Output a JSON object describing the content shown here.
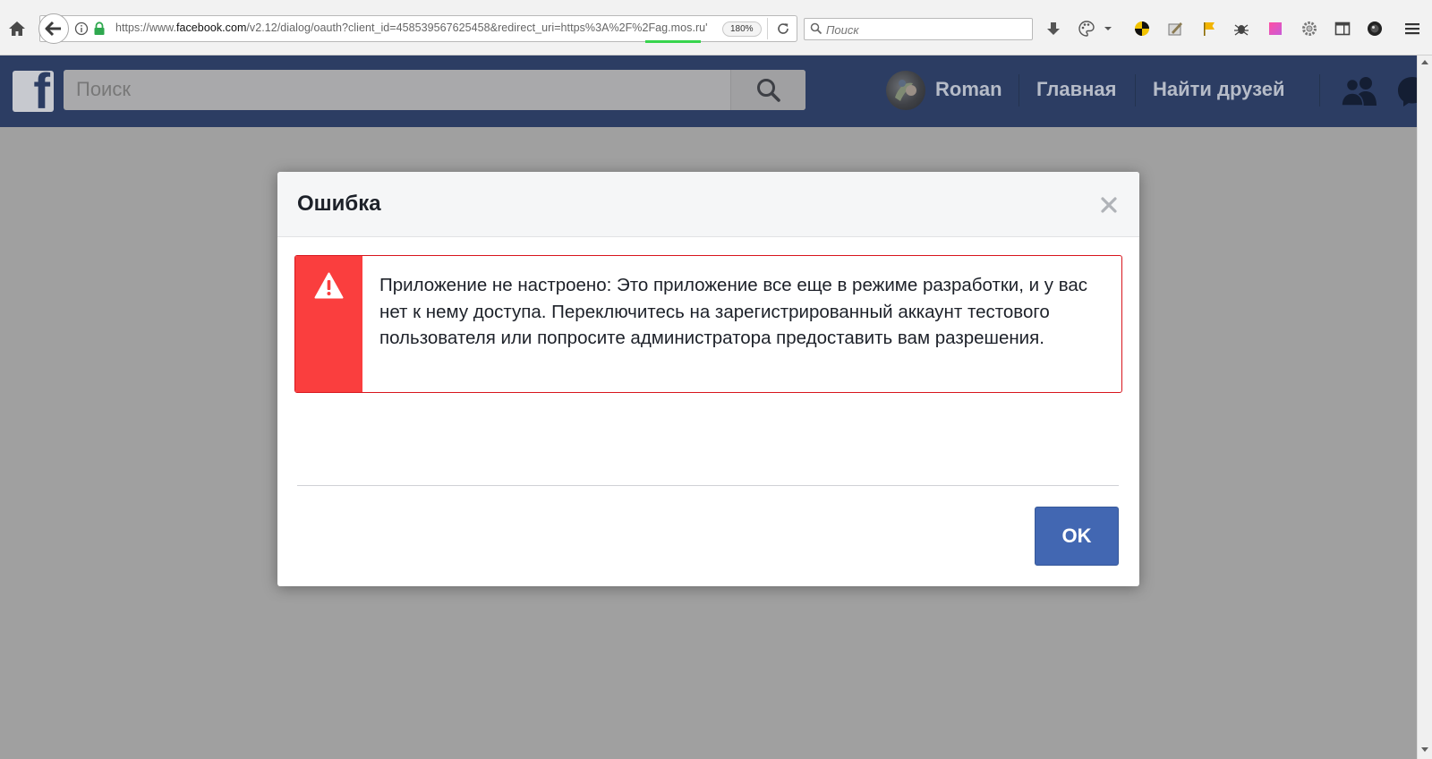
{
  "browser": {
    "url_prefix": "https://www.",
    "url_domain": "facebook.com",
    "url_rest": "/v2.12/dialog/oauth?client_id=458539567625458&redirect_uri=https%3A%2F%2Fag.mos.ru'",
    "zoom": "180%",
    "search_placeholder": "Поиск",
    "accent_underline": "#37d44d"
  },
  "facebook": {
    "logo_letter": "f",
    "search_placeholder": "Поиск",
    "user_name": "Roman",
    "nav_home": "Главная",
    "nav_find_friends": "Найти друзей",
    "bar_color": "#2c3d63"
  },
  "dialog": {
    "title": "Ошибка",
    "close_glyph": "×",
    "error_message": "Приложение не настроено: Это приложение все еще в режиме разработки, и у вас нет к нему доступа. Переключитесь на зарегистрированный аккаунт тестового пользователя или попросите администратора предоставить вам разрешения.",
    "ok_label": "OK",
    "error_color": "#fa3e3e",
    "button_color": "#4267b2"
  }
}
